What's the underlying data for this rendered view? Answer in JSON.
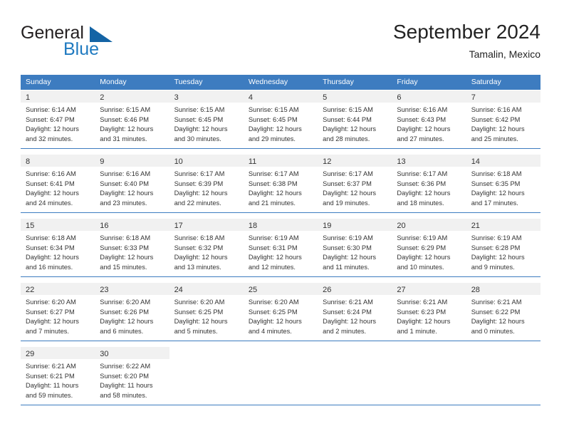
{
  "brand": {
    "name_part1": "General",
    "name_part2": "Blue",
    "accent_color": "#1f7ac0",
    "triangle_color": "#1464a5"
  },
  "header": {
    "title": "September 2024",
    "subtitle": "Tamalin, Mexico"
  },
  "calendar": {
    "header_color": "#3d7cc0",
    "daynum_band_color": "#f1f1f1",
    "weekdays": [
      "Sunday",
      "Monday",
      "Tuesday",
      "Wednesday",
      "Thursday",
      "Friday",
      "Saturday"
    ],
    "weeks": [
      [
        {
          "day": "1",
          "sunrise": "Sunrise: 6:14 AM",
          "sunset": "Sunset: 6:47 PM",
          "daylight": "Daylight: 12 hours and 32 minutes."
        },
        {
          "day": "2",
          "sunrise": "Sunrise: 6:15 AM",
          "sunset": "Sunset: 6:46 PM",
          "daylight": "Daylight: 12 hours and 31 minutes."
        },
        {
          "day": "3",
          "sunrise": "Sunrise: 6:15 AM",
          "sunset": "Sunset: 6:45 PM",
          "daylight": "Daylight: 12 hours and 30 minutes."
        },
        {
          "day": "4",
          "sunrise": "Sunrise: 6:15 AM",
          "sunset": "Sunset: 6:45 PM",
          "daylight": "Daylight: 12 hours and 29 minutes."
        },
        {
          "day": "5",
          "sunrise": "Sunrise: 6:15 AM",
          "sunset": "Sunset: 6:44 PM",
          "daylight": "Daylight: 12 hours and 28 minutes."
        },
        {
          "day": "6",
          "sunrise": "Sunrise: 6:16 AM",
          "sunset": "Sunset: 6:43 PM",
          "daylight": "Daylight: 12 hours and 27 minutes."
        },
        {
          "day": "7",
          "sunrise": "Sunrise: 6:16 AM",
          "sunset": "Sunset: 6:42 PM",
          "daylight": "Daylight: 12 hours and 25 minutes."
        }
      ],
      [
        {
          "day": "8",
          "sunrise": "Sunrise: 6:16 AM",
          "sunset": "Sunset: 6:41 PM",
          "daylight": "Daylight: 12 hours and 24 minutes."
        },
        {
          "day": "9",
          "sunrise": "Sunrise: 6:16 AM",
          "sunset": "Sunset: 6:40 PM",
          "daylight": "Daylight: 12 hours and 23 minutes."
        },
        {
          "day": "10",
          "sunrise": "Sunrise: 6:17 AM",
          "sunset": "Sunset: 6:39 PM",
          "daylight": "Daylight: 12 hours and 22 minutes."
        },
        {
          "day": "11",
          "sunrise": "Sunrise: 6:17 AM",
          "sunset": "Sunset: 6:38 PM",
          "daylight": "Daylight: 12 hours and 21 minutes."
        },
        {
          "day": "12",
          "sunrise": "Sunrise: 6:17 AM",
          "sunset": "Sunset: 6:37 PM",
          "daylight": "Daylight: 12 hours and 19 minutes."
        },
        {
          "day": "13",
          "sunrise": "Sunrise: 6:17 AM",
          "sunset": "Sunset: 6:36 PM",
          "daylight": "Daylight: 12 hours and 18 minutes."
        },
        {
          "day": "14",
          "sunrise": "Sunrise: 6:18 AM",
          "sunset": "Sunset: 6:35 PM",
          "daylight": "Daylight: 12 hours and 17 minutes."
        }
      ],
      [
        {
          "day": "15",
          "sunrise": "Sunrise: 6:18 AM",
          "sunset": "Sunset: 6:34 PM",
          "daylight": "Daylight: 12 hours and 16 minutes."
        },
        {
          "day": "16",
          "sunrise": "Sunrise: 6:18 AM",
          "sunset": "Sunset: 6:33 PM",
          "daylight": "Daylight: 12 hours and 15 minutes."
        },
        {
          "day": "17",
          "sunrise": "Sunrise: 6:18 AM",
          "sunset": "Sunset: 6:32 PM",
          "daylight": "Daylight: 12 hours and 13 minutes."
        },
        {
          "day": "18",
          "sunrise": "Sunrise: 6:19 AM",
          "sunset": "Sunset: 6:31 PM",
          "daylight": "Daylight: 12 hours and 12 minutes."
        },
        {
          "day": "19",
          "sunrise": "Sunrise: 6:19 AM",
          "sunset": "Sunset: 6:30 PM",
          "daylight": "Daylight: 12 hours and 11 minutes."
        },
        {
          "day": "20",
          "sunrise": "Sunrise: 6:19 AM",
          "sunset": "Sunset: 6:29 PM",
          "daylight": "Daylight: 12 hours and 10 minutes."
        },
        {
          "day": "21",
          "sunrise": "Sunrise: 6:19 AM",
          "sunset": "Sunset: 6:28 PM",
          "daylight": "Daylight: 12 hours and 9 minutes."
        }
      ],
      [
        {
          "day": "22",
          "sunrise": "Sunrise: 6:20 AM",
          "sunset": "Sunset: 6:27 PM",
          "daylight": "Daylight: 12 hours and 7 minutes."
        },
        {
          "day": "23",
          "sunrise": "Sunrise: 6:20 AM",
          "sunset": "Sunset: 6:26 PM",
          "daylight": "Daylight: 12 hours and 6 minutes."
        },
        {
          "day": "24",
          "sunrise": "Sunrise: 6:20 AM",
          "sunset": "Sunset: 6:25 PM",
          "daylight": "Daylight: 12 hours and 5 minutes."
        },
        {
          "day": "25",
          "sunrise": "Sunrise: 6:20 AM",
          "sunset": "Sunset: 6:25 PM",
          "daylight": "Daylight: 12 hours and 4 minutes."
        },
        {
          "day": "26",
          "sunrise": "Sunrise: 6:21 AM",
          "sunset": "Sunset: 6:24 PM",
          "daylight": "Daylight: 12 hours and 2 minutes."
        },
        {
          "day": "27",
          "sunrise": "Sunrise: 6:21 AM",
          "sunset": "Sunset: 6:23 PM",
          "daylight": "Daylight: 12 hours and 1 minute."
        },
        {
          "day": "28",
          "sunrise": "Sunrise: 6:21 AM",
          "sunset": "Sunset: 6:22 PM",
          "daylight": "Daylight: 12 hours and 0 minutes."
        }
      ],
      [
        {
          "day": "29",
          "sunrise": "Sunrise: 6:21 AM",
          "sunset": "Sunset: 6:21 PM",
          "daylight": "Daylight: 11 hours and 59 minutes."
        },
        {
          "day": "30",
          "sunrise": "Sunrise: 6:22 AM",
          "sunset": "Sunset: 6:20 PM",
          "daylight": "Daylight: 11 hours and 58 minutes."
        },
        {
          "day": "",
          "sunrise": "",
          "sunset": "",
          "daylight": ""
        },
        {
          "day": "",
          "sunrise": "",
          "sunset": "",
          "daylight": ""
        },
        {
          "day": "",
          "sunrise": "",
          "sunset": "",
          "daylight": ""
        },
        {
          "day": "",
          "sunrise": "",
          "sunset": "",
          "daylight": ""
        },
        {
          "day": "",
          "sunrise": "",
          "sunset": "",
          "daylight": ""
        }
      ]
    ]
  }
}
